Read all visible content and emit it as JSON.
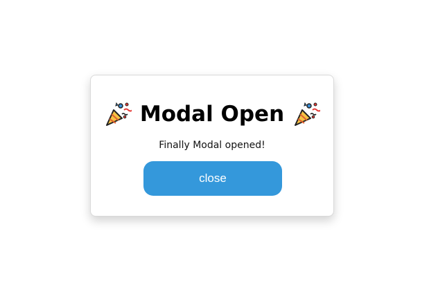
{
  "modal": {
    "title": "Modal Open",
    "title_icon": "party-popper-icon",
    "message": "Finally Modal opened!",
    "close_label": "close"
  },
  "colors": {
    "button_bg": "#3498db",
    "button_text": "#ffffff",
    "modal_bg": "#ffffff"
  }
}
